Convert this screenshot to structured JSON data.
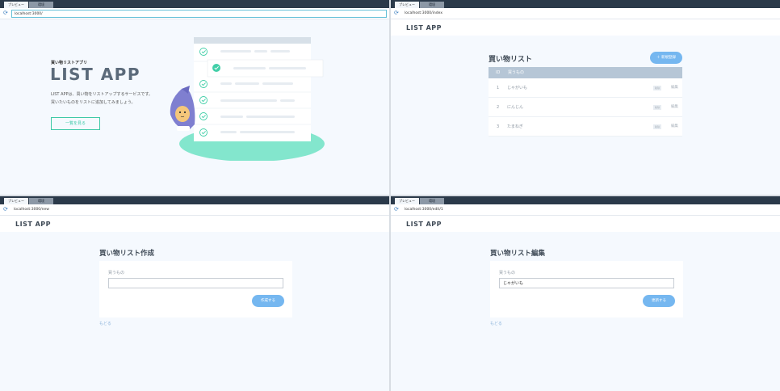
{
  "tabs": {
    "preview": "プレビュー",
    "other": "環境"
  },
  "pane1": {
    "url": "localhost:3000/",
    "hero": {
      "subtitle": "買い物リストアプリ",
      "title": "LIST APP",
      "desc_line1": "LIST APPは、買い物をリストアップするサービスです。",
      "desc_line2": "買いたいものをリストに追加してみましょう。",
      "button": "一覧を見る"
    }
  },
  "pane2": {
    "url": "localhost:3000/index",
    "app_title": "LIST APP",
    "page_title": "買い物リスト",
    "new_button": "＋ 新規登録",
    "table": {
      "headers": {
        "id": "ID",
        "name": "買うもの"
      },
      "rows": [
        {
          "id": "1",
          "name": "じゃがいも",
          "delete": "削除",
          "edit": "編集"
        },
        {
          "id": "2",
          "name": "にんじん",
          "delete": "削除",
          "edit": "編集"
        },
        {
          "id": "3",
          "name": "たまねぎ",
          "delete": "削除",
          "edit": "編集"
        }
      ]
    }
  },
  "pane3": {
    "url": "localhost:3000/new",
    "app_title": "LIST APP",
    "page_title": "買い物リスト作成",
    "label": "買うもの",
    "input_value": "",
    "submit": "作成する",
    "back": "もどる"
  },
  "pane4": {
    "url": "localhost:3000/edit/1",
    "app_title": "LIST APP",
    "page_title": "買い物リスト編集",
    "label": "買うもの",
    "input_value": "じゃがいも",
    "submit": "更新する",
    "back": "もどる"
  },
  "colors": {
    "accent_green": "#3ec9a7",
    "accent_blue": "#75b7f0",
    "table_header": "#b6c6d6",
    "ground": "#83e6cd"
  }
}
